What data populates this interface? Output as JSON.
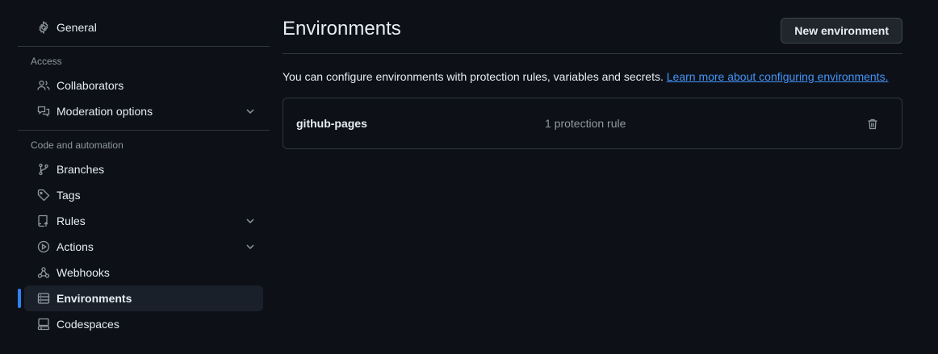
{
  "sidebar": {
    "general": {
      "label": "General",
      "icon": "gear-icon"
    },
    "access_section": "Access",
    "access_items": [
      {
        "label": "Collaborators",
        "icon": "people-icon"
      },
      {
        "label": "Moderation options",
        "icon": "comment-discussion-icon"
      }
    ],
    "code_section": "Code and automation",
    "code_items": [
      {
        "label": "Branches",
        "icon": "git-branch-icon"
      },
      {
        "label": "Tags",
        "icon": "tag-icon"
      },
      {
        "label": "Rules",
        "icon": "repo-push-icon"
      },
      {
        "label": "Actions",
        "icon": "play-icon"
      },
      {
        "label": "Webhooks",
        "icon": "webhook-icon"
      },
      {
        "label": "Environments",
        "icon": "server-icon",
        "active": true
      },
      {
        "label": "Codespaces",
        "icon": "codespaces-icon"
      }
    ]
  },
  "main": {
    "title": "Environments",
    "new_button": "New environment",
    "description": "You can configure environments with protection rules, variables and secrets.",
    "learn_more": "Learn more about configuring environments.",
    "environments": [
      {
        "name": "github-pages",
        "rules": "1 protection rule"
      }
    ]
  },
  "colors": {
    "background": "#0d1117",
    "accent": "#2f81f7",
    "link": "#4493f8",
    "border": "#30363d"
  }
}
